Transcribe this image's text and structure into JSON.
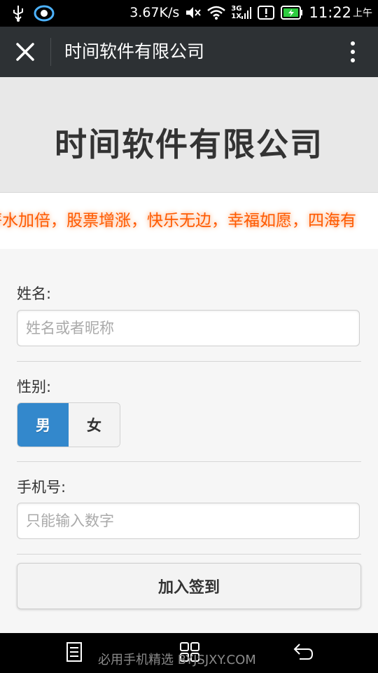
{
  "status_bar": {
    "speed": "3.67K/s",
    "network": "3G",
    "network2": "1X",
    "time": "11:22",
    "ampm": "上午"
  },
  "titlebar": {
    "title": "时间软件有限公司"
  },
  "header": {
    "heading": "时间软件有限公司"
  },
  "marquee": {
    "text": "薪水加倍，股票增涨，快乐无边，幸福如愿，四海有"
  },
  "form": {
    "name_label": "姓名:",
    "name_placeholder": "姓名或者昵称",
    "gender_label": "性别:",
    "gender_options": [
      "男",
      "女"
    ],
    "gender_selected": "男",
    "phone_label": "手机号:",
    "phone_placeholder": "只能输入数字",
    "submit_label": "加入签到"
  },
  "navbar": {
    "watermark": "必用手机精选 BYJSJXY.COM"
  },
  "colors": {
    "accent": "#3388cc",
    "marquee": "#ff5a00",
    "titlebar": "#2d3134"
  }
}
